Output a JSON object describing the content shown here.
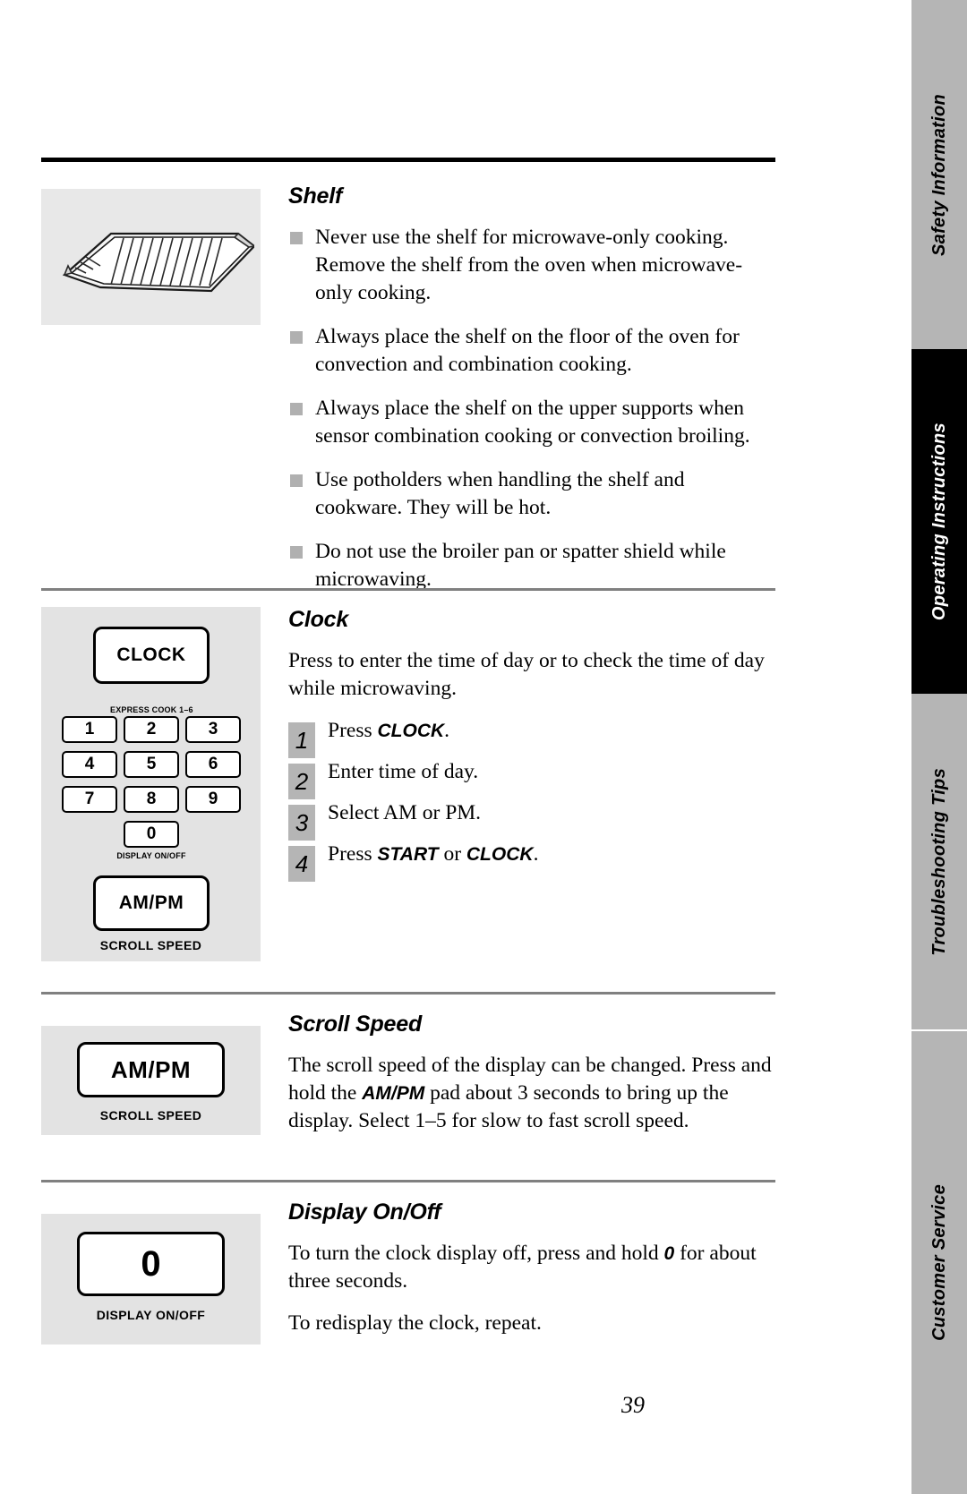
{
  "page": {
    "number": "39"
  },
  "sidebar": {
    "tabs": [
      {
        "label": "Safety Information",
        "state": "inactive"
      },
      {
        "label": "Operating Instructions",
        "state": "active"
      },
      {
        "label": "Troubleshooting Tips",
        "state": "inactive"
      },
      {
        "label": "Customer Service",
        "state": "inactive"
      }
    ]
  },
  "sections": {
    "shelf": {
      "heading": "Shelf",
      "bullets": [
        "Never use the shelf for microwave-only cooking. Remove the shelf from the oven when microwave-only cooking.",
        "Always place the shelf on the floor of the oven for convection and combination cooking.",
        "Always place the shelf on the upper supports when sensor combination cooking or convection broiling.",
        "Use potholders when handling the shelf and cookware. They will be hot.",
        "Do not use the broiler pan or spatter shield while microwaving."
      ]
    },
    "clock": {
      "heading": "Clock",
      "intro": "Press to enter the time of day or to check the time of day while microwaving.",
      "steps": [
        {
          "num": "1",
          "text_before": "Press ",
          "emphasis": "CLOCK",
          "text_after": "."
        },
        {
          "num": "2",
          "text_before": "Enter time of day.",
          "emphasis": "",
          "text_after": ""
        },
        {
          "num": "3",
          "text_before": "Select AM or PM.",
          "emphasis": "",
          "text_after": ""
        },
        {
          "num": "4",
          "text_before": "Press ",
          "emphasis": "START",
          "text_mid": " or ",
          "emphasis2": "CLOCK",
          "text_after": "."
        }
      ]
    },
    "scroll_speed": {
      "heading": "Scroll Speed",
      "body_1": "The scroll speed of the display can be changed. Press and hold the ",
      "emphasis": "AM/PM",
      "body_2": "  pad about 3 seconds to bring up the display. Select 1–5 for slow to fast scroll speed."
    },
    "display_onoff": {
      "heading": "Display On/Off",
      "body_1": "To turn the clock display off, press and hold ",
      "emphasis": "0",
      "body_2": " for about three seconds.",
      "body_3": "To redisplay the clock, repeat."
    }
  },
  "keypad_figure": {
    "clock_key": "CLOCK",
    "express_label": "EXPRESS COOK  1–6",
    "number_keys": [
      "1",
      "2",
      "3",
      "4",
      "5",
      "6",
      "7",
      "8",
      "9"
    ],
    "zero_key": "0",
    "display_label": "DISPLAY ON/OFF",
    "ampm_key": "AM/PM",
    "scroll_caption": "SCROLL SPEED"
  },
  "scroll_figure": {
    "ampm_key": "AM/PM",
    "caption": "SCROLL SPEED"
  },
  "display_figure": {
    "zero_key": "0",
    "caption": "DISPLAY ON/OFF"
  },
  "colors": {
    "tab_gray": "#b5b5b5",
    "tab_active": "#000000",
    "figure_bg": "#e8e8e8",
    "panel_bg": "#e3e3e3",
    "bullet_square": "#b0b0b0",
    "step_square": "#b5b5b5",
    "rule_gray": "#808080"
  }
}
